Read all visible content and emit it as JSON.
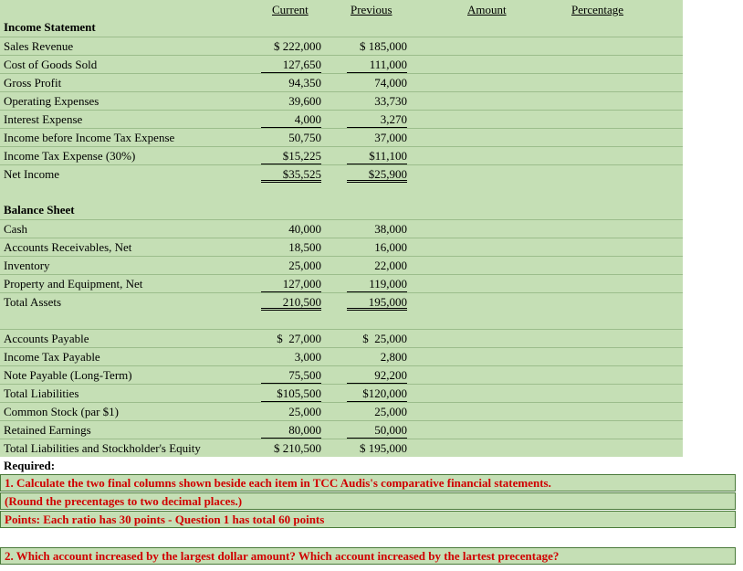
{
  "headers": {
    "current": "Current",
    "previous": "Previous",
    "amount": "Amount",
    "percentage": "Percentage"
  },
  "income_statement": {
    "title": "Income Statement",
    "rows": [
      {
        "label": "Sales Revenue",
        "current": "$ 222,000",
        "previous": "$ 185,000"
      },
      {
        "label": "Cost of Goods Sold",
        "current": "127,650",
        "previous": "111,000"
      },
      {
        "label": "Gross Profit",
        "current": "94,350",
        "previous": "74,000"
      },
      {
        "label": "Operating Expenses",
        "current": "39,600",
        "previous": "33,730"
      },
      {
        "label": "Interest Expense",
        "current": "4,000",
        "previous": "3,270"
      },
      {
        "label": "Income before Income Tax Expense",
        "current": "50,750",
        "previous": "37,000"
      },
      {
        "label": "Income Tax Expense (30%)",
        "current": "$15,225",
        "previous": "$11,100"
      },
      {
        "label": "Net Income",
        "current": "$35,525",
        "previous": "$25,900"
      }
    ]
  },
  "balance_sheet": {
    "title": "Balance Sheet",
    "assets": [
      {
        "label": "Cash",
        "current": "40,000",
        "previous": "38,000"
      },
      {
        "label": "Accounts Receivables, Net",
        "current": "18,500",
        "previous": "16,000"
      },
      {
        "label": "Inventory",
        "current": "25,000",
        "previous": "22,000"
      },
      {
        "label": "Property and Equipment, Net",
        "current": "127,000",
        "previous": "119,000"
      },
      {
        "label": "Total Assets",
        "current": "210,500",
        "previous": "195,000"
      }
    ],
    "liabilities": [
      {
        "label": "Accounts Payable",
        "current": "$  27,000",
        "previous": "$  25,000"
      },
      {
        "label": "Income Tax Payable",
        "current": "3,000",
        "previous": "2,800"
      },
      {
        "label": "Note Payable (Long-Term)",
        "current": "75,500",
        "previous": "92,200"
      },
      {
        "label": "Total Liabilities",
        "current": "$105,500",
        "previous": "$120,000"
      },
      {
        "label": "Common Stock (par $1)",
        "current": "25,000",
        "previous": "25,000"
      },
      {
        "label": "Retained Earnings",
        "current": "80,000",
        "previous": "50,000"
      },
      {
        "label": "Total Liabilities and Stockholder's Equity",
        "current": "$ 210,500",
        "previous": "$ 195,000"
      }
    ]
  },
  "required": {
    "label": "Required:",
    "q1": "1. Calculate the two final columns shown beside each item in TCC Audis's comparative financial statements.",
    "q1_note": "(Round the precentages to two decimal places.)",
    "points": "Points: Each ratio has 30 points - Question 1 has total 60 points",
    "q2": "2. Which account increased by the largest dollar amount? Which account increased by the lartest precentage?"
  },
  "colors": {
    "sheet_bg": "#c5dfb5",
    "question_text": "#d00000",
    "border": "#4a7a3a"
  }
}
